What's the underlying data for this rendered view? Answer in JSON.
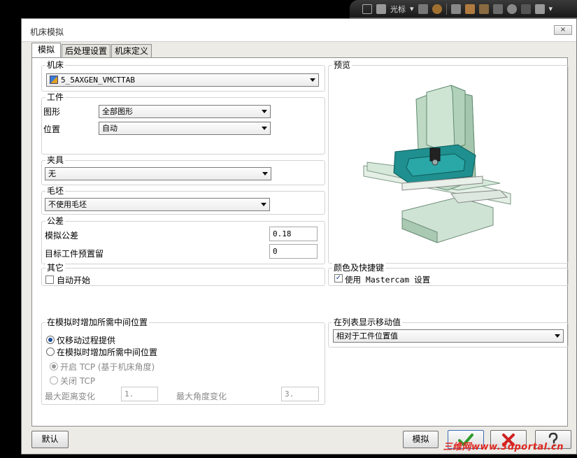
{
  "window": {
    "title": "机床模拟",
    "close_label": "×"
  },
  "toolbar": {
    "cursor_label": "光标"
  },
  "tabs": [
    {
      "label": "模拟"
    },
    {
      "label": "后处理设置"
    },
    {
      "label": "机床定义"
    }
  ],
  "machine": {
    "legend": "机床",
    "selected": "5_5AXGEN_VMCTTAB"
  },
  "workpiece": {
    "legend": "工件",
    "shape_label": "图形",
    "shape_value": "全部图形",
    "position_label": "位置",
    "position_value": "自动"
  },
  "fixture": {
    "legend": "夹具",
    "value": "无"
  },
  "stock": {
    "legend": "毛坯",
    "value": "不使用毛坯"
  },
  "tolerance": {
    "legend": "公差",
    "sim_label": "模拟公差",
    "sim_value": "0.18",
    "offset_label": "目标工件预置留",
    "offset_value": "0"
  },
  "other": {
    "legend": "其它",
    "autostart_label": "自动开始"
  },
  "preview": {
    "legend": "预览"
  },
  "colors_shortcuts": {
    "legend": "颜色及快捷键",
    "use_mastercam_label": "使用 Mastercam 设置"
  },
  "intermediate": {
    "legend": "在模拟时增加所需中间位置",
    "opt_only_provided": "仅移动过程提供",
    "opt_add_intermediate": "在模拟时增加所需中间位置",
    "tcp_on": "开启 TCP (基于机床角度)",
    "tcp_off": "关闭 TCP",
    "max_dist_label": "最大距离变化",
    "max_dist_value": "1.",
    "max_angle_label": "最大角度变化",
    "max_angle_value": "3."
  },
  "list_display": {
    "legend": "在列表显示移动值",
    "value": "相对于工件位置值"
  },
  "buttons": {
    "default_label": "默认",
    "simulate_label": "模拟",
    "ok_icon": "checkmark-icon",
    "cancel_icon": "x-icon",
    "help_icon": "help-icon"
  },
  "watermark": "三维网www.3dportal.cn",
  "colors": {
    "ok_green": "#2a9a2a",
    "cancel_red": "#d02020",
    "machine_green": "#b9d6c0",
    "machine_teal": "#1f8f8f"
  }
}
